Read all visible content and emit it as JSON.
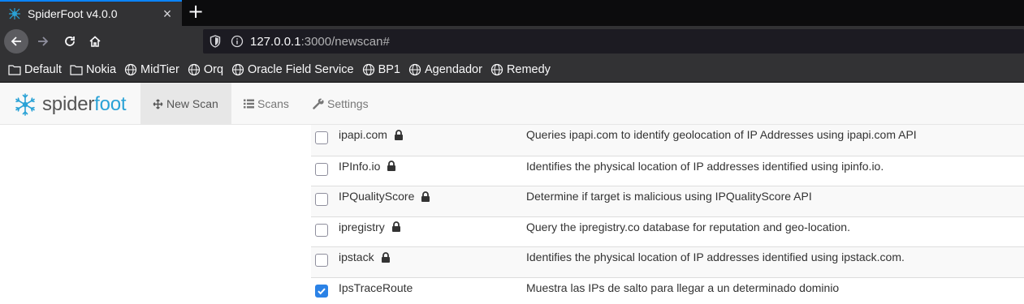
{
  "browser": {
    "tab_title": "SpiderFoot v4.0.0",
    "tab_close": "×",
    "new_tab": "+",
    "url_host": "127.0.0.1",
    "url_rest": ":3000/newscan#",
    "bookmarks": [
      {
        "label": "Default",
        "icon": "folder-icon"
      },
      {
        "label": "Nokia",
        "icon": "folder-icon"
      },
      {
        "label": "MidTier",
        "icon": "globe-icon"
      },
      {
        "label": "Orq",
        "icon": "globe-icon"
      },
      {
        "label": "Oracle Field Service",
        "icon": "globe-icon"
      },
      {
        "label": "BP1",
        "icon": "globe-icon"
      },
      {
        "label": "Agendador",
        "icon": "globe-icon"
      },
      {
        "label": "Remedy",
        "icon": "globe-icon"
      }
    ]
  },
  "app": {
    "brand_spider": "spider",
    "brand_foot": "foot",
    "nav": {
      "new_scan": "New Scan",
      "scans": "Scans",
      "settings": "Settings"
    }
  },
  "modules": [
    {
      "name": "ipapi.com",
      "locked": true,
      "checked": false,
      "description": "Queries ipapi.com to identify geolocation of IP Addresses using ipapi.com API"
    },
    {
      "name": "IPInfo.io",
      "locked": true,
      "checked": false,
      "description": "Identifies the physical location of IP addresses identified using ipinfo.io."
    },
    {
      "name": "IPQualityScore",
      "locked": true,
      "checked": false,
      "description": "Determine if target is malicious using IPQualityScore API"
    },
    {
      "name": "ipregistry",
      "locked": true,
      "checked": false,
      "description": "Query the ipregistry.co database for reputation and geo-location."
    },
    {
      "name": "ipstack",
      "locked": true,
      "checked": false,
      "description": "Identifies the physical location of IP addresses identified using ipstack.com."
    },
    {
      "name": "IpsTraceRoute",
      "locked": false,
      "checked": true,
      "description": "Muestra las IPs de salto para llegar a un determinado dominio"
    }
  ],
  "colors": {
    "accent": "#0a84ff",
    "brand_blue": "#2aa2d6",
    "checkbox_checked": "#2b82e6"
  }
}
